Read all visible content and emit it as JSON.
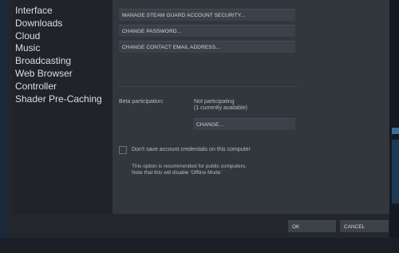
{
  "sidebar": {
    "items": [
      {
        "label": "Interface"
      },
      {
        "label": "Downloads"
      },
      {
        "label": "Cloud"
      },
      {
        "label": "Music"
      },
      {
        "label": "Broadcasting"
      },
      {
        "label": "Web Browser"
      },
      {
        "label": "Controller"
      },
      {
        "label": "Shader Pre-Caching"
      }
    ]
  },
  "account": {
    "manage_guard_label": "MANAGE STEAM GUARD ACCOUNT SECURITY...",
    "change_password_label": "CHANGE PASSWORD...",
    "change_email_label": "CHANGE CONTACT EMAIL ADDRESS..."
  },
  "beta": {
    "label": "Beta participation:",
    "status_line1": "Not participating",
    "status_line2": "(1 currently available)",
    "change_label": "CHANGE..."
  },
  "credentials": {
    "checkbox_label": "Don't save account credentials on this computer",
    "checked": false,
    "note_line1": "This option is recommended for public computers.",
    "note_line2": "Note that this will disable 'Offline Mode.'"
  },
  "footer": {
    "ok_label": "OK",
    "cancel_label": "CANCEL"
  },
  "colors": {
    "dialog_bg": "#23262b",
    "content_bg": "#32363d",
    "button_bg": "#3c4048"
  }
}
